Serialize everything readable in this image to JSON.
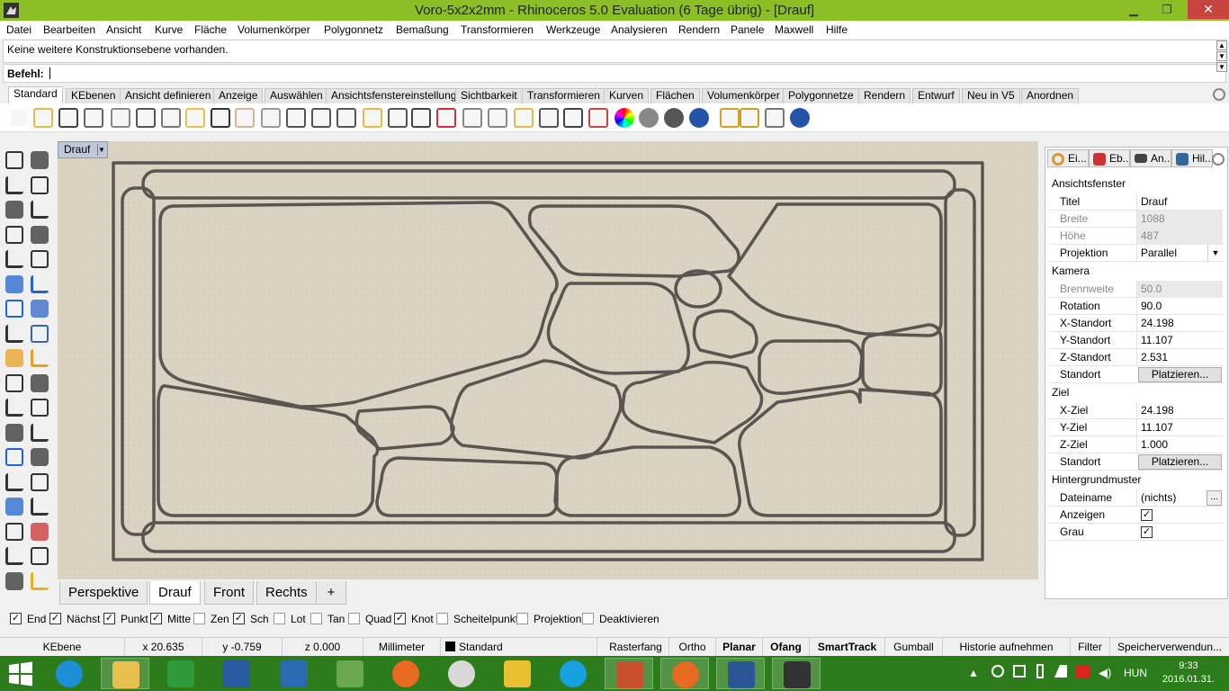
{
  "window": {
    "title": "Voro-5x2x2mm - Rhinoceros 5.0 Evaluation (6 Tage übrig) - [Drauf]",
    "minimize_glyph": "▁",
    "maximize_glyph": "❐",
    "close_glyph": "✕"
  },
  "menu": [
    "Datei",
    "Bearbeiten",
    "Ansicht",
    "Kurve",
    "Fläche",
    "Volumenkörper",
    "Polygonnetz",
    "Bemaßung",
    "Transformieren",
    "Werkzeuge",
    "Analysieren",
    "Rendern",
    "Panele",
    "Maxwell",
    "Hilfe"
  ],
  "command": {
    "history": "Keine weitere Konstruktionsebene vorhanden.",
    "prompt_label": "Befehl:",
    "value": ""
  },
  "toolbar_tabs": [
    "Standard",
    "KEbenen",
    "Ansicht definieren",
    "Anzeige",
    "Auswählen",
    "Ansichtsfenstereinstellung",
    "Sichtbarkeit",
    "Transformieren",
    "Kurven",
    "Flächen",
    "Volumenkörper",
    "Polygonnetze",
    "Rendern",
    "Entwurf",
    "Neu in V5",
    "Anordnen"
  ],
  "toolbar_icons": [
    "new-file-icon",
    "open-folder-icon",
    "save-icon",
    "print-icon",
    "import-icon",
    "cut-icon",
    "copy-icon",
    "paste-icon",
    "undo-icon",
    "pan-hand-icon",
    "rotate-view-icon",
    "zoom-icon",
    "zoom-window-icon",
    "zoom-extents-icon",
    "zoom-selected-icon",
    "rotate-3d-icon",
    "four-viewports-icon",
    "car-icon",
    "camera-icon",
    "circle-arrow-icon",
    "grid-snap-icon",
    "light-bulb-icon",
    "lock-icon",
    "layer-icon",
    "color-wheel-icon",
    "sphere-gray-icon",
    "sphere-dark-icon",
    "sphere-blue-icon",
    "render-icon",
    "gear-options-icon",
    "settings-icon",
    "help-icon"
  ],
  "viewport": {
    "label": "Drauf",
    "tabs": [
      "Perspektive",
      "Drauf",
      "Front",
      "Rechts"
    ],
    "active_tab": "Drauf",
    "add_tab_glyph": "+"
  },
  "properties_panel": {
    "tabs": [
      "Ei...",
      "Eb...",
      "An...",
      "Hil..."
    ],
    "sections": {
      "viewport": "Ansichtsfenster",
      "camera": "Kamera",
      "target": "Ziel",
      "background": "Hintergrundmuster"
    },
    "viewport_rows": [
      {
        "key": "Titel",
        "value": "Drauf",
        "disabled": false
      },
      {
        "key": "Breite",
        "value": "1088",
        "disabled": true
      },
      {
        "key": "Höhe",
        "value": "487",
        "disabled": true
      },
      {
        "key": "Projektion",
        "value": "Parallel",
        "disabled": false
      }
    ],
    "camera_rows": [
      {
        "key": "Brennweite",
        "value": "50.0",
        "disabled": true
      },
      {
        "key": "Rotation",
        "value": "90.0",
        "disabled": false
      },
      {
        "key": "X-Standort",
        "value": "24.198",
        "disabled": false
      },
      {
        "key": "Y-Standort",
        "value": "11.107",
        "disabled": false
      },
      {
        "key": "Z-Standort",
        "value": "2.531",
        "disabled": false
      }
    ],
    "camera_location_label": "Standort",
    "place_button": "Platzieren...",
    "target_rows": [
      {
        "key": "X-Ziel",
        "value": "24.198",
        "disabled": false
      },
      {
        "key": "Y-Ziel",
        "value": "11.107",
        "disabled": false
      },
      {
        "key": "Z-Ziel",
        "value": "1.000",
        "disabled": false
      }
    ],
    "target_location_label": "Standort",
    "filename_label": "Dateiname",
    "filename_value": "(nichts)",
    "show_label": "Anzeigen",
    "show_checked": true,
    "gray_label": "Grau",
    "gray_checked": true
  },
  "osnaps": [
    {
      "label": "End",
      "checked": true
    },
    {
      "label": "Nächst",
      "checked": true
    },
    {
      "label": "Punkt",
      "checked": true
    },
    {
      "label": "Mitte",
      "checked": true
    },
    {
      "label": "Zen",
      "checked": false
    },
    {
      "label": "Sch",
      "checked": true
    },
    {
      "label": "Lot",
      "checked": false
    },
    {
      "label": "Tan",
      "checked": false
    },
    {
      "label": "Quad",
      "checked": false
    },
    {
      "label": "Knot",
      "checked": true
    },
    {
      "label": "Scheitelpunkt",
      "checked": false
    },
    {
      "label": "Projektion",
      "checked": false
    },
    {
      "label": "Deaktivieren",
      "checked": false
    }
  ],
  "status": {
    "cplane": "KEbene",
    "x": "x 20.635",
    "y": "y -0.759",
    "z": "z 0.000",
    "units": "Millimeter",
    "layer": "Standard",
    "toggles": [
      "Rasterfang",
      "Ortho",
      "Planar",
      "Ofang",
      "SmartTrack",
      "Gumball",
      "Historie aufnehmen",
      "Filter",
      "Speicherverwendun..."
    ]
  },
  "taskbar": {
    "apps": [
      "internet-explorer-icon",
      "file-explorer-icon",
      "store-icon",
      "control-panel-icon",
      "messenger-icon",
      "evernote-icon",
      "firefox-icon",
      "chrome-icon",
      "tools-icon",
      "skype-icon",
      "rhino-r-icon",
      "firefox-icon-2",
      "word-icon",
      "rhino-icon"
    ],
    "language": "HUN",
    "time": "9:33",
    "date": "2016.01.31."
  },
  "colors": {
    "titlebar": "#8cbf26",
    "taskbar": "#2c7c1c",
    "viewport_bg": "#d9d2c3",
    "curve": "#5a5550"
  }
}
